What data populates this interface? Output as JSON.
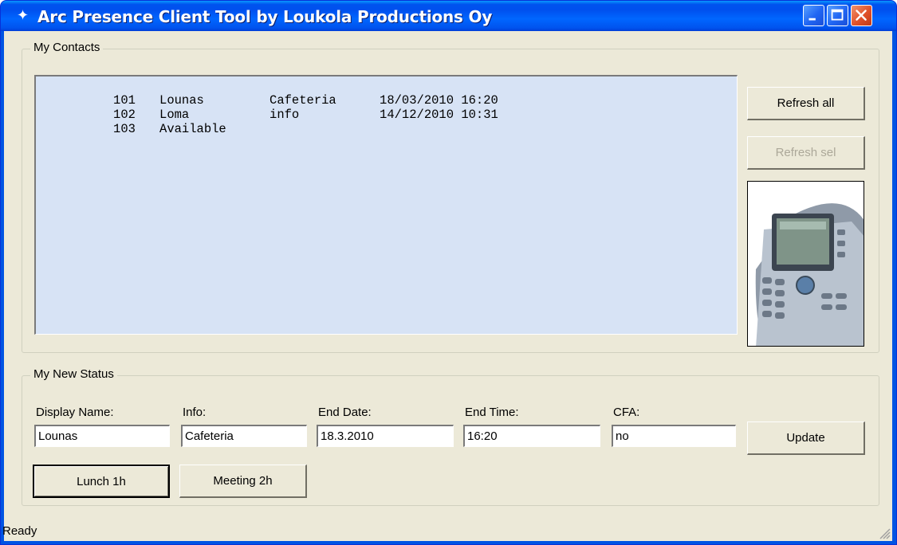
{
  "window": {
    "title": "Arc Presence Client Tool by Loukola Productions Oy",
    "icon": "arc-star-icon",
    "controls": {
      "minimize": "minimize-icon",
      "maximize": "maximize-icon",
      "close": "close-icon"
    }
  },
  "contacts_group": {
    "legend": "My Contacts",
    "rows": [
      {
        "ext": "101",
        "name": "Lounas",
        "info": "Cafeteria",
        "end": "18/03/2010 16:20"
      },
      {
        "ext": "102",
        "name": "Loma",
        "info": "info",
        "end": "14/12/2010 10:31"
      },
      {
        "ext": "103",
        "name": "Available",
        "info": "",
        "end": ""
      }
    ],
    "refresh_all_label": "Refresh all",
    "refresh_sel_label": "Refresh sel",
    "phone_image": "ip-phone-image"
  },
  "status_group": {
    "legend": "My New Status",
    "display_name": {
      "label": "Display Name:",
      "value": "Lounas"
    },
    "info": {
      "label": "Info:",
      "value": "Cafeteria"
    },
    "end_date": {
      "label": "End Date:",
      "value": "18.3.2010"
    },
    "end_time": {
      "label": "End Time:",
      "value": "16:20"
    },
    "cfa": {
      "label": "CFA:",
      "value": "no"
    },
    "update_label": "Update",
    "lunch_label": "Lunch 1h",
    "meeting_label": "Meeting 2h"
  },
  "statusbar": {
    "text": "Ready"
  },
  "colors": {
    "titlebar": "#0054e3",
    "window_bg": "#ece9d8",
    "list_bg": "#d7e3f5"
  }
}
